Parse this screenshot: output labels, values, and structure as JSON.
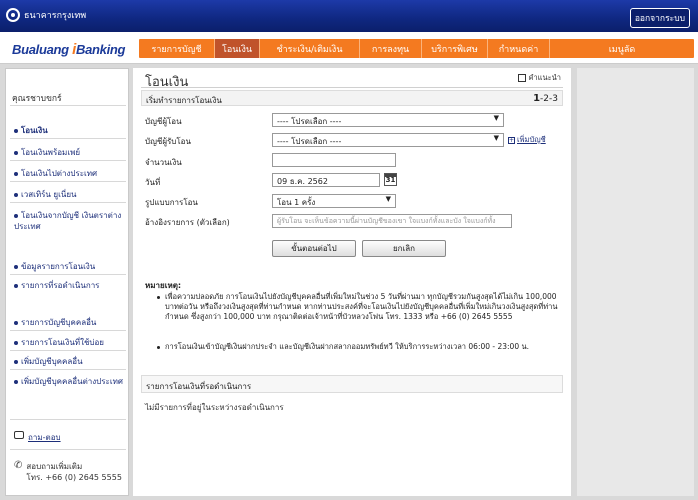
{
  "bank": {
    "name": "ธนาคารกรุงเทพ",
    "logout_label": "ออกจากระบบ"
  },
  "brand": {
    "logo_prefix": "Bualuang",
    "logo_i": "i",
    "logo_suffix": "Banking"
  },
  "menu": [
    {
      "label": "รายการบัญชี"
    },
    {
      "label": "โอนเงิน"
    },
    {
      "label": "ชำระเงิน/เติมเงิน"
    },
    {
      "label": "การลงทุน"
    },
    {
      "label": "บริการพิเศษ"
    },
    {
      "label": "กำหนดค่า"
    },
    {
      "label": "เมนูลัด"
    }
  ],
  "sidebar": {
    "user_name": "คุณรชาบขกร์",
    "items": [
      {
        "label": "โอนเงิน"
      },
      {
        "label": "โอนเงินพร้อมเพย์"
      },
      {
        "label": "โอนเงินไปต่างประเทศ"
      },
      {
        "label": "เวสเทิร์น ยูเนี่ยน"
      },
      {
        "label": "โอนเงินจากบัญชี เงินตราต่างประเทศ"
      },
      {
        "label": "ข้อมูลรายการโอนเงิน"
      },
      {
        "label": "รายการที่รอดำเนินการ"
      },
      {
        "label": "รายการบัญชีบุคคลอื่น"
      },
      {
        "label": "รายการโอนเงินที่ใช้บ่อย"
      },
      {
        "label": "เพิ่มบัญชีบุคคลอื่น"
      },
      {
        "label": "เพิ่มบัญชีบุคคลอื่นต่างประเทศ"
      }
    ],
    "faq_label": "ถาม-ตอบ",
    "contact_label": "สอบถามเพิ่มเติม",
    "contact_phone": "โทร. +66 (0) 2645 5555"
  },
  "main": {
    "title": "โอนเงิน",
    "help_label": "คำแนะนำ",
    "section_title": "เริ่มทำรายการโอนเงิน",
    "steps_current": "1",
    "steps_rest": "-2-3",
    "from_account_label": "บัญชีผู้โอน",
    "from_account_value": "---- โปรดเลือก ----",
    "to_account_label": "บัญชีผู้รับโอน",
    "to_account_value": "---- โปรดเลือก ----",
    "add_account_label": "เพิ่มบัญชี",
    "amount_label": "จำนวนเงิน",
    "amount_value": "",
    "date_label": "วันที่",
    "date_value": "09 ธ.ค. 2562",
    "calendar_day": "31",
    "transfer_type_label": "รูปแบบการโอน",
    "transfer_type_value": "โอน 1 ครั้ง",
    "reference_label": "อ้างอิงรายการ (ตัวเลือก)",
    "reference_placeholder": "ผู้รับโอน จะเห็นข้อความนี้ผ่านบัญชีของเขา ใจแบงก์ทั้งและบัง ใจแบงก์ทั้ง",
    "next_button": "ขั้นตอนต่อไป",
    "cancel_button": "ยกเลิก",
    "note_title": "หมายเหตุ:",
    "note_1": "เพื่อความปลอดภัย การโอนเงินไปยังบัญชีบุคคลอื่นที่เพิ่มใหม่ในช่วง 5 วันที่ผ่านมา ทุกบัญชีรวมกันสูงสุดได้ไม่เกิน 100,000 บาทต่อวัน หรือถึงวงเงินสูงสุดที่ท่านกำหนด หากท่านประสงค์ที่จะโอนเงินไปยังบัญชีบุคคลอื่นที่เพิ่มใหม่เกินวงเงินสูงสุดที่ท่านกำหนด ซึ่งสูงกว่า 100,000 บาท กรุณาติดต่อเจ้าหน้าที่บัวหลวงโฟน โทร. 1333 หรือ +66 (0) 2645 5555",
    "note_2": "การโอนเงินเข้าบัญชีเงินฝากประจำ และบัญชีเงินฝากสลากออมทรัพย์ทวี ให้บริการระหว่างเวลา 06:00 - 23:00 น.",
    "pending_title": "รายการโอนเงินที่รอดำเนินการ",
    "pending_empty": "ไม่มีรายการที่อยู่ในระหว่างรอดำเนินการ"
  }
}
